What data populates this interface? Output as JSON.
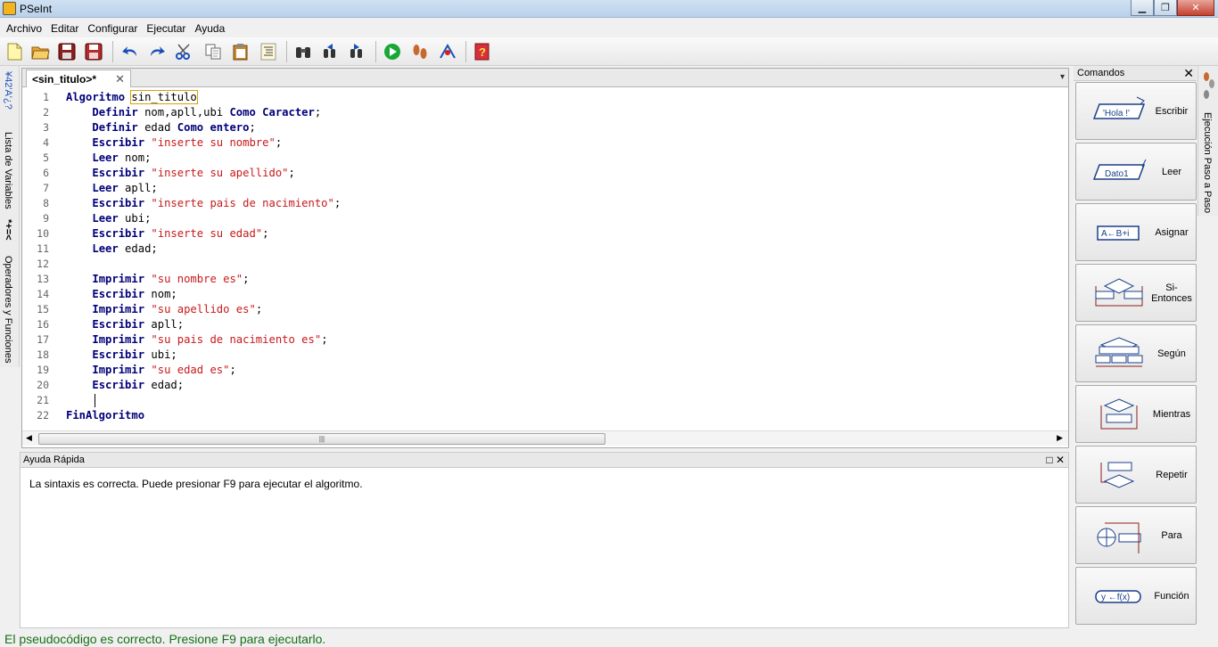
{
  "window": {
    "title": "PSeInt",
    "minimize": "▁",
    "maximize": "❐",
    "close": "✕"
  },
  "menu": [
    "Archivo",
    "Editar",
    "Configurar",
    "Ejecutar",
    "Ayuda"
  ],
  "toolbar_icons": [
    "new-file-icon",
    "open-folder-icon",
    "save-icon",
    "save-as-icon",
    "undo-icon",
    "redo-icon",
    "cut-icon",
    "copy-icon",
    "paste-icon",
    "indent-icon",
    "find-icon",
    "find-prev-icon",
    "find-next-icon",
    "run-icon",
    "step-icon",
    "flowchart-icon",
    "help-icon"
  ],
  "left_panel": {
    "variables_symbol": "¥42'A'¿?",
    "variables_label": "Lista de Variables",
    "operators_symbol": "*+=<",
    "operators_label": "Operadores y Funciones"
  },
  "right_panel": {
    "label": "Ejecución Paso a Paso"
  },
  "editor": {
    "tab_label": "<sin_titulo>*",
    "tab_close": "✕",
    "dropdown": "▾",
    "lines": [
      {
        "n": "1",
        "parts": [
          {
            "t": "Algoritmo",
            "c": "kw"
          },
          {
            "t": " ",
            "c": "tx"
          },
          {
            "t": "sin_titulo",
            "c": "tx sel-box"
          }
        ]
      },
      {
        "n": "2",
        "parts": [
          {
            "t": "    ",
            "c": "tx"
          },
          {
            "t": "Definir",
            "c": "kw"
          },
          {
            "t": " nom,apll,ubi ",
            "c": "tx"
          },
          {
            "t": "Como Caracter",
            "c": "kw"
          },
          {
            "t": ";",
            "c": "tx"
          }
        ]
      },
      {
        "n": "3",
        "parts": [
          {
            "t": "    ",
            "c": "tx"
          },
          {
            "t": "Definir",
            "c": "kw"
          },
          {
            "t": " edad ",
            "c": "tx"
          },
          {
            "t": "Como entero",
            "c": "kw"
          },
          {
            "t": ";",
            "c": "tx"
          }
        ]
      },
      {
        "n": "4",
        "parts": [
          {
            "t": "    ",
            "c": "tx"
          },
          {
            "t": "Escribir",
            "c": "kw"
          },
          {
            "t": " ",
            "c": "tx"
          },
          {
            "t": "\"inserte su nombre\"",
            "c": "str"
          },
          {
            "t": ";",
            "c": "tx"
          }
        ]
      },
      {
        "n": "5",
        "parts": [
          {
            "t": "    ",
            "c": "tx"
          },
          {
            "t": "Leer",
            "c": "kw"
          },
          {
            "t": " nom;",
            "c": "tx"
          }
        ]
      },
      {
        "n": "6",
        "parts": [
          {
            "t": "    ",
            "c": "tx"
          },
          {
            "t": "Escribir",
            "c": "kw"
          },
          {
            "t": " ",
            "c": "tx"
          },
          {
            "t": "\"inserte su apellido\"",
            "c": "str"
          },
          {
            "t": ";",
            "c": "tx"
          }
        ]
      },
      {
        "n": "7",
        "parts": [
          {
            "t": "    ",
            "c": "tx"
          },
          {
            "t": "Leer",
            "c": "kw"
          },
          {
            "t": " apll;",
            "c": "tx"
          }
        ]
      },
      {
        "n": "8",
        "parts": [
          {
            "t": "    ",
            "c": "tx"
          },
          {
            "t": "Escribir",
            "c": "kw"
          },
          {
            "t": " ",
            "c": "tx"
          },
          {
            "t": "\"inserte pais de nacimiento\"",
            "c": "str"
          },
          {
            "t": ";",
            "c": "tx"
          }
        ]
      },
      {
        "n": "9",
        "parts": [
          {
            "t": "    ",
            "c": "tx"
          },
          {
            "t": "Leer",
            "c": "kw"
          },
          {
            "t": " ubi;",
            "c": "tx"
          }
        ]
      },
      {
        "n": "10",
        "parts": [
          {
            "t": "    ",
            "c": "tx"
          },
          {
            "t": "Escribir",
            "c": "kw"
          },
          {
            "t": " ",
            "c": "tx"
          },
          {
            "t": "\"inserte su edad\"",
            "c": "str"
          },
          {
            "t": ";",
            "c": "tx"
          }
        ]
      },
      {
        "n": "11",
        "parts": [
          {
            "t": "    ",
            "c": "tx"
          },
          {
            "t": "Leer",
            "c": "kw"
          },
          {
            "t": " edad;",
            "c": "tx"
          }
        ]
      },
      {
        "n": "12",
        "parts": []
      },
      {
        "n": "13",
        "parts": [
          {
            "t": "    ",
            "c": "tx"
          },
          {
            "t": "Imprimir",
            "c": "kw"
          },
          {
            "t": " ",
            "c": "tx"
          },
          {
            "t": "\"su nombre es\"",
            "c": "str"
          },
          {
            "t": ";",
            "c": "tx"
          }
        ]
      },
      {
        "n": "14",
        "parts": [
          {
            "t": "    ",
            "c": "tx"
          },
          {
            "t": "Escribir",
            "c": "kw"
          },
          {
            "t": " nom;",
            "c": "tx"
          }
        ]
      },
      {
        "n": "15",
        "parts": [
          {
            "t": "    ",
            "c": "tx"
          },
          {
            "t": "Imprimir",
            "c": "kw"
          },
          {
            "t": " ",
            "c": "tx"
          },
          {
            "t": "\"su apellido es\"",
            "c": "str"
          },
          {
            "t": ";",
            "c": "tx"
          }
        ]
      },
      {
        "n": "16",
        "parts": [
          {
            "t": "    ",
            "c": "tx"
          },
          {
            "t": "Escribir",
            "c": "kw"
          },
          {
            "t": " apll;",
            "c": "tx"
          }
        ]
      },
      {
        "n": "17",
        "parts": [
          {
            "t": "    ",
            "c": "tx"
          },
          {
            "t": "Imprimir",
            "c": "kw"
          },
          {
            "t": " ",
            "c": "tx"
          },
          {
            "t": "\"su pais de nacimiento es\"",
            "c": "str"
          },
          {
            "t": ";",
            "c": "tx"
          }
        ]
      },
      {
        "n": "18",
        "parts": [
          {
            "t": "    ",
            "c": "tx"
          },
          {
            "t": "Escribir",
            "c": "kw"
          },
          {
            "t": " ubi;",
            "c": "tx"
          }
        ]
      },
      {
        "n": "19",
        "parts": [
          {
            "t": "    ",
            "c": "tx"
          },
          {
            "t": "Imprimir",
            "c": "kw"
          },
          {
            "t": " ",
            "c": "tx"
          },
          {
            "t": "\"su edad es\"",
            "c": "str"
          },
          {
            "t": ";",
            "c": "tx"
          }
        ]
      },
      {
        "n": "20",
        "parts": [
          {
            "t": "    ",
            "c": "tx"
          },
          {
            "t": "Escribir",
            "c": "kw"
          },
          {
            "t": " edad;",
            "c": "tx"
          }
        ]
      },
      {
        "n": "21",
        "parts": [],
        "caret": true
      },
      {
        "n": "22",
        "parts": [
          {
            "t": "FinAlgoritmo",
            "c": "kw"
          }
        ]
      }
    ]
  },
  "help": {
    "title": "Ayuda Rápida",
    "restore": "□",
    "close": "✕",
    "message": "La sintaxis es correcta. Puede presionar F9 para ejecutar el algoritmo."
  },
  "commands": {
    "title": "Comandos",
    "close": "✕",
    "items": [
      {
        "label": "Escribir",
        "icon": "write-icon",
        "sample": "'Hola !'"
      },
      {
        "label": "Leer",
        "icon": "read-icon",
        "sample": "Dato1"
      },
      {
        "label": "Asignar",
        "icon": "assign-icon",
        "sample": "A←B+i"
      },
      {
        "label": "Si-Entonces",
        "icon": "if-icon"
      },
      {
        "label": "Según",
        "icon": "switch-icon"
      },
      {
        "label": "Mientras",
        "icon": "while-icon"
      },
      {
        "label": "Repetir",
        "icon": "repeat-icon"
      },
      {
        "label": "Para",
        "icon": "for-icon"
      },
      {
        "label": "Función",
        "icon": "function-icon",
        "sample": "y ←f(x)"
      }
    ]
  },
  "status": {
    "text": "El pseudocódigo es correcto. Presione F9 para ejecutarlo.",
    "color": "#186e18"
  }
}
